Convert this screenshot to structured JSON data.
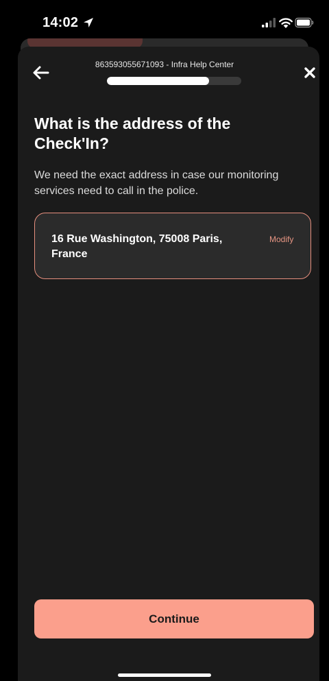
{
  "status_bar": {
    "time": "14:02",
    "location_icon": "location-arrow-icon",
    "signal_icon": "cellular-signal-icon",
    "wifi_icon": "wifi-icon",
    "battery_icon": "battery-icon"
  },
  "header": {
    "title": "863593055671093 - Infra Help Center",
    "back_icon": "arrow-left-icon",
    "close_icon": "close-icon",
    "progress_fraction": 0.76
  },
  "question": {
    "title": "What is the address of the Check'In?",
    "subtitle": "We need the exact address in case our monitoring services need to call in the police."
  },
  "address_card": {
    "address": "16 Rue Washington, 75008 Paris, France",
    "modify_label": "Modify"
  },
  "footer": {
    "continue_label": "Continue"
  },
  "colors": {
    "accent": "#fb9f8c",
    "card_border": "#e8907f",
    "sheet_background": "#1b1b1b",
    "card_background": "#2b2b2b"
  }
}
